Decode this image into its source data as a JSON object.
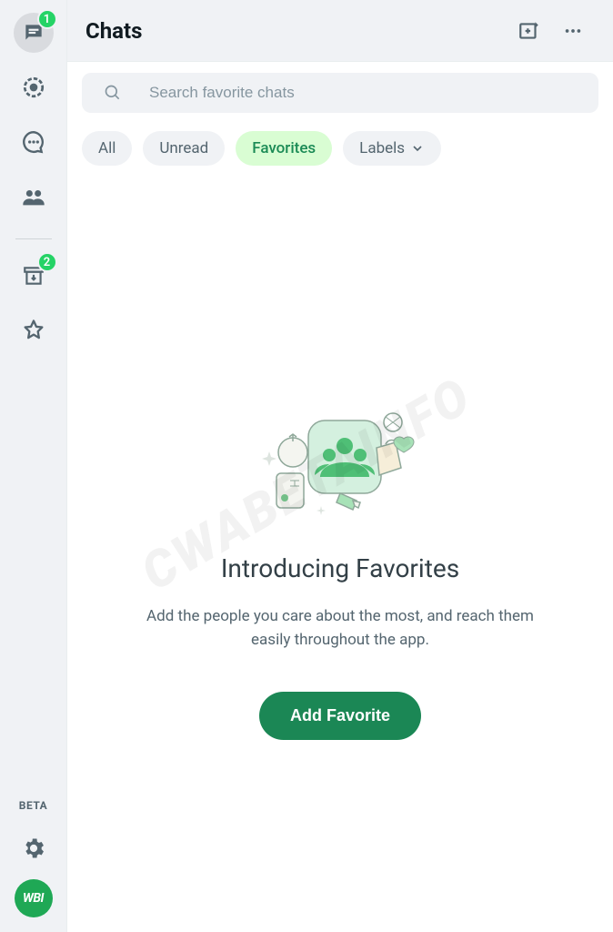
{
  "sidebar": {
    "chats_badge": "1",
    "archive_badge": "2",
    "beta_label": "BETA",
    "avatar_text": "WBI"
  },
  "header": {
    "title": "Chats"
  },
  "search": {
    "placeholder": "Search favorite chats"
  },
  "filters": {
    "all": "All",
    "unread": "Unread",
    "favorites": "Favorites",
    "labels": "Labels"
  },
  "empty": {
    "title": "Introducing Favorites",
    "description": "Add the people you care about the most, and reach them easily throughout the app.",
    "button": "Add Favorite"
  },
  "watermark": "CWABETAINFO"
}
